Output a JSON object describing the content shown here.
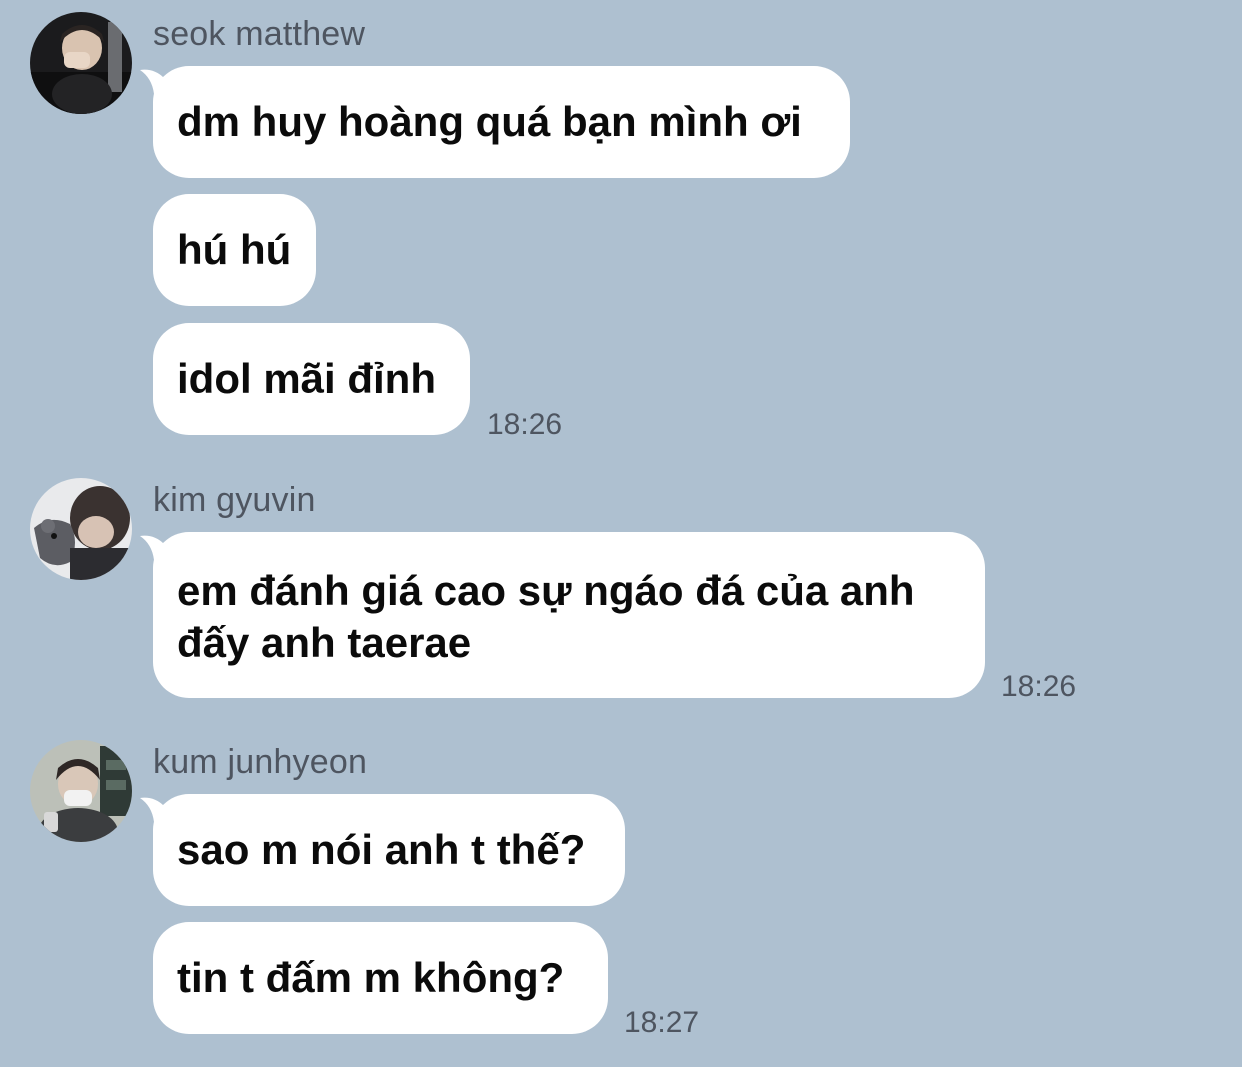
{
  "groups": [
    {
      "sender": "seok matthew",
      "avatar_icon": "profile-photo",
      "messages": [
        "dm huy hoàng quá bạn mình ơi",
        "hú hú",
        "idol mãi đỉnh"
      ],
      "time": "18:26"
    },
    {
      "sender": "kim gyuvin",
      "avatar_icon": "profile-photo",
      "messages": [
        "em đánh giá cao sự ngáo đá của anh\nđấy anh taerae"
      ],
      "time": "18:26"
    },
    {
      "sender": "kum junhyeon",
      "avatar_icon": "profile-photo",
      "messages": [
        "sao m nói anh t thế?",
        "tin t đấm m không?"
      ],
      "time": "18:27"
    }
  ],
  "colors": {
    "background": "#aec0d0",
    "bubble": "#ffffff",
    "meta_text": "#4e5560"
  }
}
